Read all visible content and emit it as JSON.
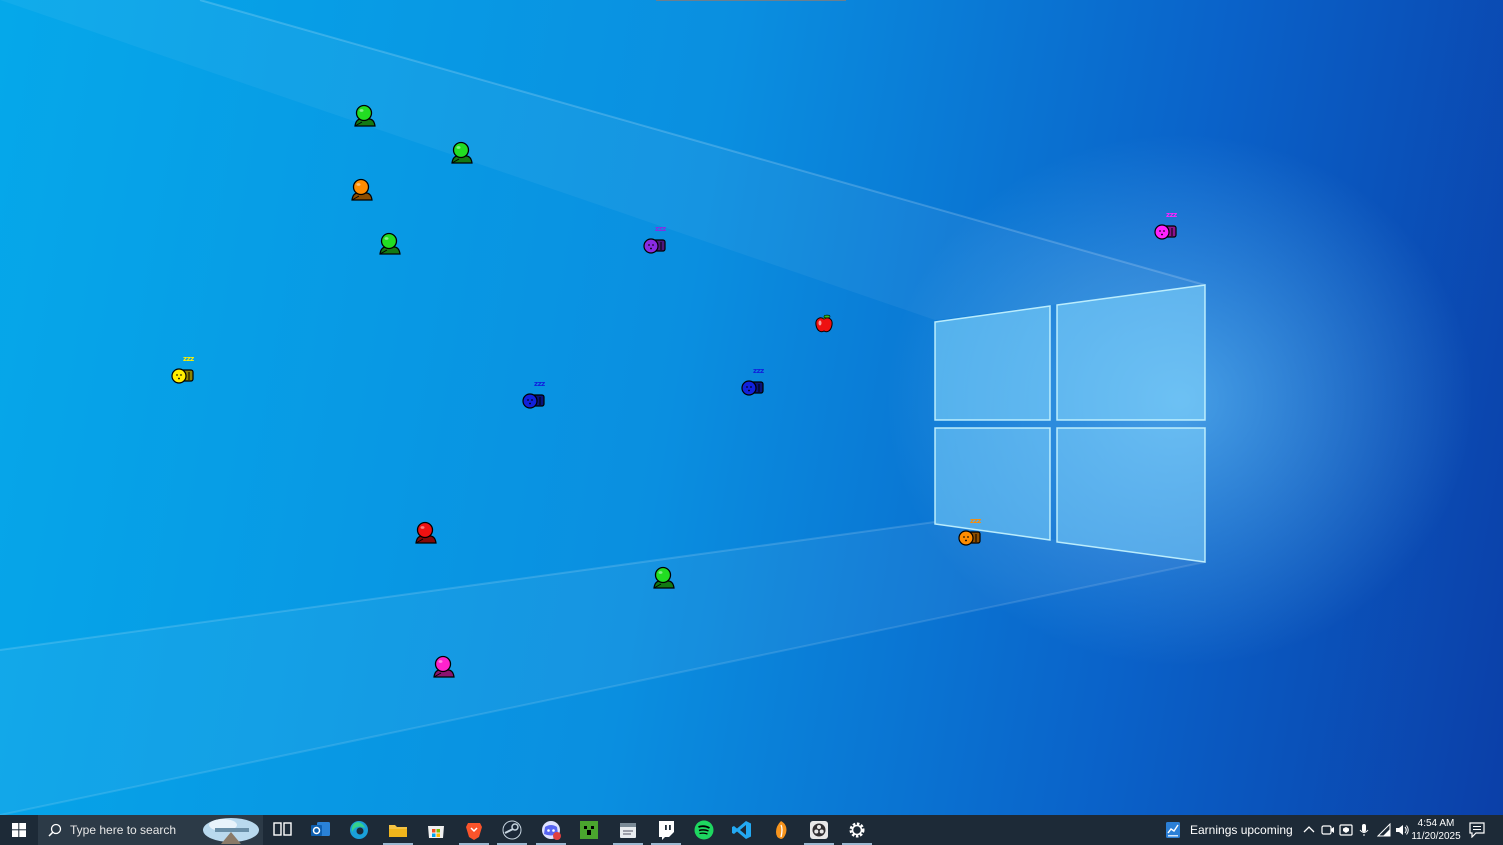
{
  "taskbar": {
    "search_placeholder": "Type here to search",
    "news_text": "Earnings upcoming",
    "clock_time": "4:54 AM",
    "clock_date": "11/20/2025",
    "pinned_apps": [
      "task-view",
      "outlook",
      "edge",
      "file-explorer",
      "microsoft-store",
      "brave",
      "steam",
      "discord",
      "minecraft",
      "notepad",
      "twitch",
      "spotify",
      "vs-code",
      "fl-studio",
      "obs",
      "settings"
    ]
  },
  "desktop": {
    "zzz_label": "zzz",
    "creatures": [
      {
        "color": "#22dd22",
        "state": "awake"
      },
      {
        "color": "#22dd22",
        "state": "awake"
      },
      {
        "color": "#ff8c00",
        "state": "awake"
      },
      {
        "color": "#22dd22",
        "state": "awake"
      },
      {
        "color": "#8a2be2",
        "state": "sleeping"
      },
      {
        "color": "#ff22ff",
        "state": "sleeping"
      },
      {
        "color": "#ffee00",
        "state": "sleeping"
      },
      {
        "color": "#1122dd",
        "state": "sleeping"
      },
      {
        "color": "#1122dd",
        "state": "sleeping"
      },
      {
        "color": "#ee1111",
        "state": "awake"
      },
      {
        "color": "#ff8c00",
        "state": "sleeping"
      },
      {
        "color": "#22dd22",
        "state": "awake"
      },
      {
        "color": "#ff22cc",
        "state": "awake"
      }
    ],
    "food": [
      {
        "type": "apple",
        "color": "#ee1111"
      }
    ]
  }
}
